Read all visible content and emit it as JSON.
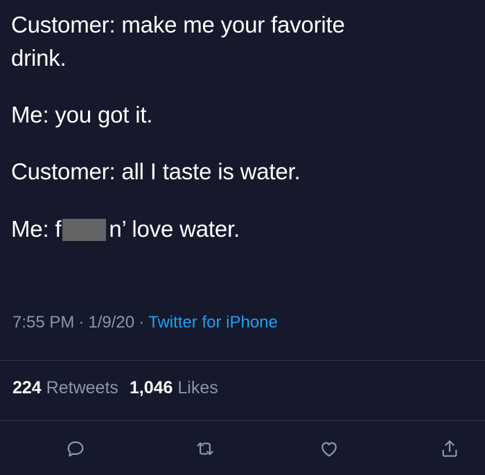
{
  "tweet": {
    "lines": [
      "Customer: make me your favorite",
      "drink.",
      "Me: you got it.",
      "Customer: all I taste is water.",
      "Me: f"
    ],
    "line5_after_censor": "n’ love water.",
    "timestamp": "7:55 PM",
    "date": "1/9/20",
    "source": "Twitter for iPhone",
    "separator": "·"
  },
  "stats": {
    "retweets_count": "224",
    "retweets_label": "Retweets",
    "likes_count": "1,046",
    "likes_label": "Likes"
  },
  "actions": {
    "icons": [
      "reply-icon",
      "retweet-icon",
      "like-icon",
      "share-icon"
    ]
  },
  "colors": {
    "background": "#15192b",
    "text": "#ffffff",
    "muted": "#8b98a5",
    "link": "#1da1f2",
    "censor": "#636466",
    "divider": "#2f3544"
  }
}
